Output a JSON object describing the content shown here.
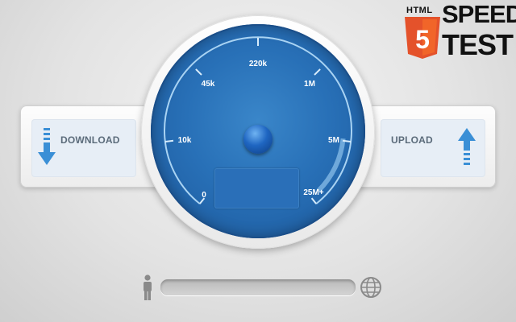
{
  "app": {
    "logo": {
      "html": "HTML",
      "badge": "5",
      "speed": "SPEED",
      "test": "TEST"
    }
  },
  "download_panel": {
    "label": "DOWNLOAD",
    "icon": "download-arrow-icon"
  },
  "upload_panel": {
    "label": "UPLOAD",
    "icon": "upload-arrow-icon"
  },
  "gauge": {
    "scale_labels": [
      "0",
      "10k",
      "45k",
      "220k",
      "1M",
      "5M",
      "25M+"
    ],
    "readout_value": ""
  },
  "progress": {
    "value_percent": 0,
    "left_icon": "person-icon",
    "right_icon": "globe-icon"
  },
  "colors": {
    "dial_blue": "#2870b7",
    "panel_bg": "#e7eef6",
    "logo_orange": "#e4522b",
    "arrow_blue": "#3a8fd6"
  }
}
